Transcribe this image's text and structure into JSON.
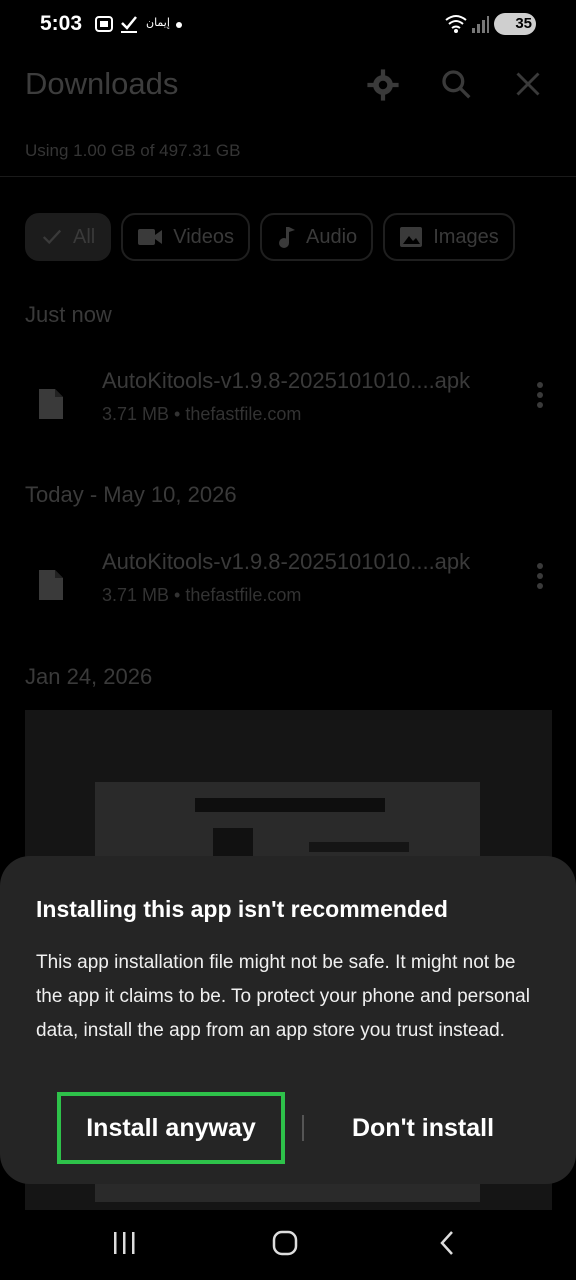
{
  "status_bar": {
    "time": "5:03",
    "notification_text": "إيمان",
    "battery": "35"
  },
  "app": {
    "title": "Downloads",
    "storage_text": "Using 1.00 GB of 497.31 GB",
    "icons": [
      "settings-icon",
      "search-icon",
      "close-icon"
    ],
    "filters": [
      {
        "label": "All",
        "icon": "check-icon"
      },
      {
        "label": "Videos",
        "icon": "video-icon"
      },
      {
        "label": "Audio",
        "icon": "music-note-icon"
      },
      {
        "label": "Images",
        "icon": "image-icon"
      }
    ],
    "sections": [
      {
        "heading": "Just now",
        "files": [
          {
            "name": "AutoKitools-v1.9.8-2025101010....apk",
            "meta": "3.71 MB • thefastfile.com"
          }
        ]
      },
      {
        "heading": "Today - May 10, 2026",
        "files": [
          {
            "name": "AutoKitools-v1.9.8-2025101010....apk",
            "meta": "3.71 MB • thefastfile.com"
          }
        ]
      },
      {
        "heading": "Jan 24, 2026",
        "files": []
      }
    ]
  },
  "dialog": {
    "title": "Installing this app isn't recommended",
    "body": "This app installation file might not be safe. It might not be the app it claims to be. To protect your phone and personal data, install the app from an app store you trust instead.",
    "install_label": "Install anyway",
    "dont_install_label": "Don't install",
    "highlight_color": "#2ec24a"
  },
  "navbar": {
    "buttons": [
      "recent-apps-icon",
      "home-icon",
      "back-icon"
    ]
  }
}
